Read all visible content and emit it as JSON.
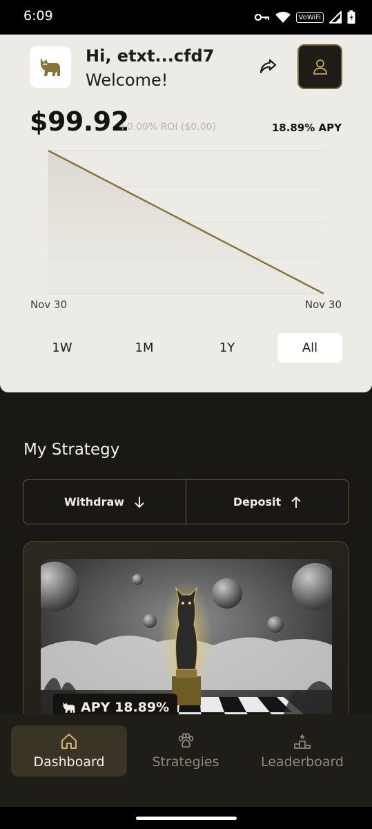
{
  "status_bar": {
    "time": "6:09",
    "wifi_label": "VoWiFi"
  },
  "header": {
    "greeting": "Hi, etxt...cfd7",
    "welcome": "Welcome!"
  },
  "portfolio": {
    "balance": "$99.92",
    "roi": "+0.00% ROI ($0.00)",
    "apy": "18.89% APY"
  },
  "chart_data": {
    "type": "area",
    "x": [
      "Nov 30",
      "Nov 30"
    ],
    "series": [
      {
        "values": [
          4,
          0
        ]
      }
    ],
    "x_tick_labels": [
      "Nov 30",
      "Nov 30"
    ],
    "grid": true,
    "accent_color": "#8a7336"
  },
  "range_tabs": [
    {
      "label": "1W",
      "active": false
    },
    {
      "label": "1M",
      "active": false
    },
    {
      "label": "1Y",
      "active": false
    },
    {
      "label": "All",
      "active": true
    }
  ],
  "strategy": {
    "title": "My Strategy",
    "withdraw_label": "Withdraw",
    "deposit_label": "Deposit",
    "badge_apy": "APY 18.89%"
  },
  "nav": [
    {
      "label": "Dashboard",
      "icon": "home-icon",
      "active": true
    },
    {
      "label": "Strategies",
      "icon": "paw-icon",
      "active": false
    },
    {
      "label": "Leaderboard",
      "icon": "podium-icon",
      "active": false
    }
  ],
  "colors": {
    "accent": "#8a7336",
    "dark_bg": "#1a1814",
    "card_bg": "#ecebe6"
  }
}
